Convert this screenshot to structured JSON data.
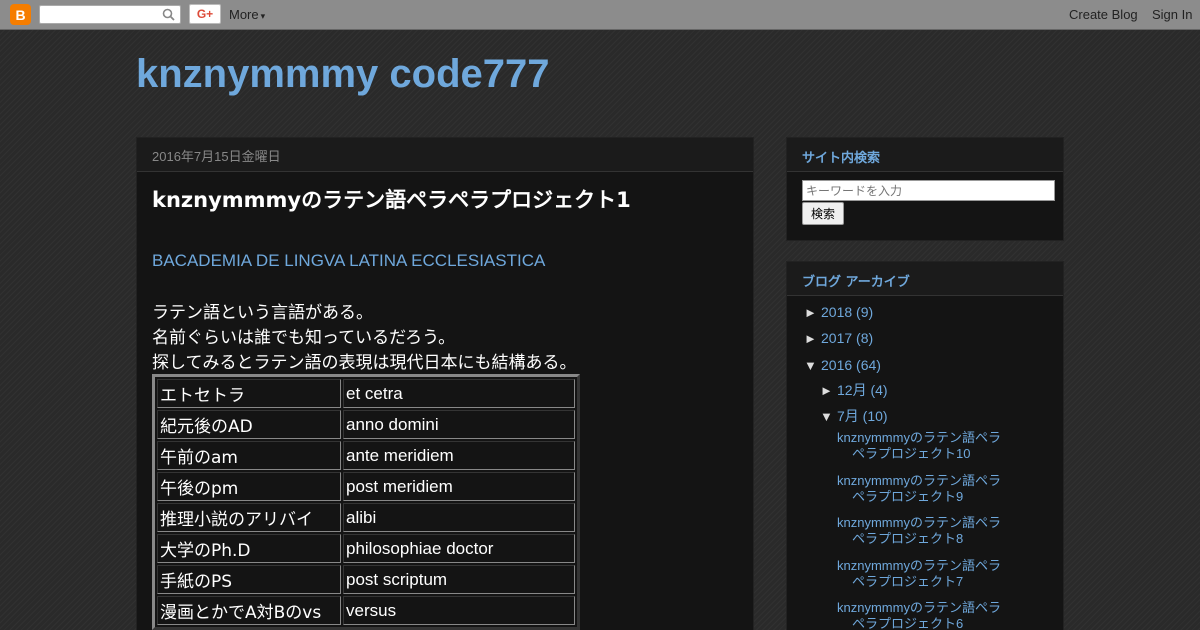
{
  "navbar": {
    "more_label": "More",
    "create_blog": "Create Blog",
    "sign_in": "Sign In",
    "gplus_label": "G+"
  },
  "blog": {
    "title": "knznymmmy code777"
  },
  "post": {
    "date": "2016年7月15日金曜日",
    "title": "knznymmmyのラテン語ペラペラプロジェクト1",
    "link": "BACADEMIA DE LINGVA LATINA ECCLESIASTICA",
    "lines": [
      "ラテン語という言語がある。",
      "名前ぐらいは誰でも知っているだろう。",
      "探してみるとラテン語の表現は現代日本にも結構ある。"
    ],
    "table": [
      {
        "jp": "エトセトラ",
        "la": "et cetra"
      },
      {
        "jp": "紀元後のAD",
        "la": "anno domini"
      },
      {
        "jp": "午前のam",
        "la": "ante meridiem"
      },
      {
        "jp": "午後のpm",
        "la": "post meridiem"
      },
      {
        "jp": "推理小説のアリバイ",
        "la": "alibi"
      },
      {
        "jp": "大学のPh.D",
        "la": "philosophiae doctor"
      },
      {
        "jp": "手紙のPS",
        "la": "post scriptum"
      },
      {
        "jp": "漫画とかでA対Bのvs",
        "la": "versus"
      }
    ]
  },
  "sidebar": {
    "search": {
      "title": "サイト内検索",
      "placeholder": "キーワードを入力",
      "button": "検索"
    },
    "archive": {
      "title": "ブログ アーカイブ",
      "years": [
        {
          "toggle": "►",
          "label": "2018 (9)"
        },
        {
          "toggle": "►",
          "label": "2017 (8)"
        },
        {
          "toggle": "▼",
          "label": "2016 (64)"
        }
      ],
      "months": [
        {
          "toggle": "►",
          "label": "12月 (4)"
        },
        {
          "toggle": "▼",
          "label": "7月 (10)"
        }
      ],
      "posts": [
        "knznymmmyのラテン語ペラペラプロジェクト10",
        "knznymmmyのラテン語ペラペラプロジェクト9",
        "knznymmmyのラテン語ペラペラプロジェクト8",
        "knznymmmyのラテン語ペラペラプロジェクト7",
        "knznymmmyのラテン語ペラペラプロジェクト6"
      ]
    }
  },
  "colors": {
    "link": "#6fa8dc",
    "navbar": "#8c8c8c",
    "blogger_orange": "#f57d00"
  }
}
